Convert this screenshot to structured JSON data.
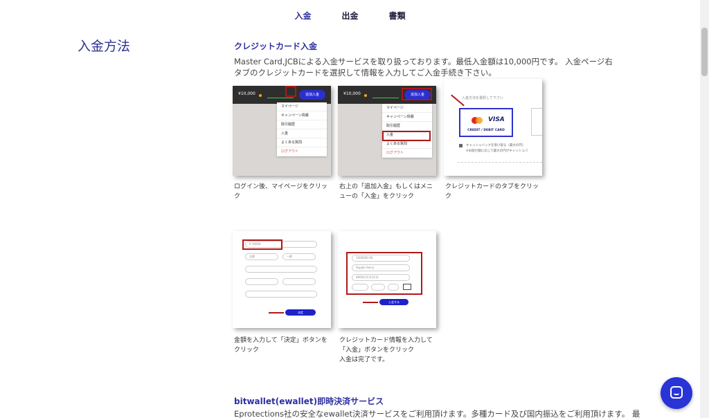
{
  "tabs": [
    {
      "label": "入金"
    },
    {
      "label": "出金"
    },
    {
      "label": "書類"
    }
  ],
  "section": {
    "title": "入金方法"
  },
  "credit": {
    "heading": "クレジットカード入金",
    "description": "Master Card,JCBによる入金サービスを取り扱っております。最低入金額は10,000円です。 入金ページ右タブのクレジットカードを選択して情報を入力してご入金手続き下さい。"
  },
  "steps": [
    {
      "caption": "ログイン後、マイページをクリック"
    },
    {
      "caption": "右上の「追加入金」もしくはメニューの「入金」をクリック"
    },
    {
      "caption": "クレジットカードのタブをクリック"
    },
    {
      "caption": "金額を入力して「決定」ボタンをクリック"
    },
    {
      "caption": "クレジットカード情報を入力して「入金」ボタンをクリック\n入金は完了です。"
    }
  ],
  "mock": {
    "balance": "¥10,000",
    "add_button": "追加入金",
    "menu_items": [
      "マイページ",
      "キャンペーン情報",
      "取引履歴",
      "入金",
      "よくある質問",
      "ログアウト"
    ],
    "card_prompt": "入金方法を選択して下さい",
    "card_label": "CREDIT / DEBIT CARD",
    "visa": "VISA",
    "cashback_line1": "キャッシュバックを受け取る（最大の円）",
    "cashback_line2": "※お取引額に応じて最大の円がキャッシュバ",
    "amount_placeholder": "¥ 10000",
    "name_first": "太郎",
    "name_last": "一郎",
    "card_field1": "1000000 00",
    "card_field2": "Supple Anica",
    "card_field3": "4000111111111",
    "submit_decide": "決定",
    "submit_deposit": "入金する"
  },
  "bitwallet": {
    "heading": "bitwallet(ewallet)即時決済サービス",
    "description": "Eprotections社の安全なewallet決済サービスをご利用頂けます。多種カード及び国内振込をご利用頂けます。 最"
  },
  "colors": {
    "accent": "#2d3390",
    "button": "#2b2fcf",
    "highlight": "#b01818"
  },
  "chat": {
    "icon": "chat-icon"
  }
}
